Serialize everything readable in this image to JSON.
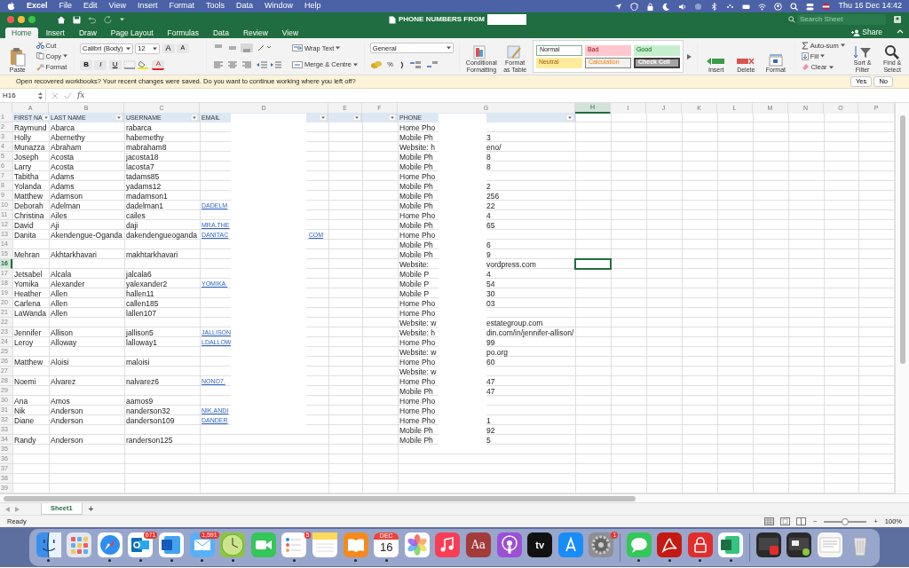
{
  "menu_bar": {
    "app": "Excel",
    "items": [
      "File",
      "Edit",
      "View",
      "Insert",
      "Format",
      "Tools",
      "Data",
      "Window",
      "Help"
    ],
    "clock": "Thu 16 Dec 14:42"
  },
  "title_bar": {
    "title": "PHONE NUMBERS FROM",
    "search": {
      "placeholder": "Search Sheet"
    }
  },
  "tabs": [
    {
      "label": "Home",
      "selected": true
    },
    {
      "label": "Insert",
      "selected": false
    },
    {
      "label": "Draw",
      "selected": false
    },
    {
      "label": "Page Layout",
      "selected": false
    },
    {
      "label": "Formulas",
      "selected": false
    },
    {
      "label": "Data",
      "selected": false
    },
    {
      "label": "Review",
      "selected": false
    },
    {
      "label": "View",
      "selected": false
    }
  ],
  "share": "Share",
  "ribbon": {
    "paste": "Paste",
    "clipboard": [
      "Cut",
      "Copy",
      "Format"
    ],
    "font": "Calibri (Body)",
    "font_size": "12",
    "grow": "A",
    "shrink": "A",
    "bold": "B",
    "italic": "I",
    "underline": "U",
    "font_color": "A",
    "wrap_text": "Wrap Text",
    "merge": "Merge & Centre",
    "number_format": "General",
    "percent": "%",
    "conditional": "Conditional Formatting",
    "format_table": "Format as Table",
    "styles": [
      {
        "label": "Normal",
        "kind": "normal"
      },
      {
        "label": "Bad",
        "kind": "bad"
      },
      {
        "label": "Good",
        "kind": "good"
      },
      {
        "label": "Neutral",
        "kind": "neutral"
      },
      {
        "label": "Calculation",
        "kind": "calculation"
      },
      {
        "label": "Check Cell",
        "kind": "check"
      }
    ],
    "cells": [
      "Insert",
      "Delete",
      "Format"
    ],
    "editing": [
      "Auto-sum",
      "Fill",
      "Clear"
    ],
    "sort": "Sort & Filter",
    "find": "Find & Select"
  },
  "notice": {
    "text": "Open recovered workbooks?  Your recent changes were saved. Do you want to continue working where you left off?",
    "buttons": [
      "Yes",
      "No"
    ]
  },
  "formula_bar": {
    "name_box": "H16",
    "fx": "fx"
  },
  "sheet": {
    "columns": [
      {
        "letter": "A",
        "selected": false
      },
      {
        "letter": "B",
        "selected": false
      },
      {
        "letter": "C",
        "selected": false
      },
      {
        "letter": "D",
        "selected": false
      },
      {
        "letter": "E",
        "selected": false
      },
      {
        "letter": "F",
        "selected": false
      },
      {
        "letter": "G",
        "selected": false
      },
      {
        "letter": "H",
        "selected": true
      },
      {
        "letter": "I",
        "selected": false
      },
      {
        "letter": "J",
        "selected": false
      },
      {
        "letter": "K",
        "selected": false
      },
      {
        "letter": "L",
        "selected": false
      },
      {
        "letter": "M",
        "selected": false
      },
      {
        "letter": "N",
        "selected": false
      },
      {
        "letter": "O",
        "selected": false
      },
      {
        "letter": "P",
        "selected": false
      }
    ],
    "rows": [
      {
        "number": "1",
        "selected": false,
        "kind": "header",
        "cells": {
          "A": {
            "text": "FIRST NA",
            "filter": true
          },
          "B": {
            "text": "LAST NAME",
            "filter": true
          },
          "C": {
            "text": "USERNAME",
            "filter": true
          },
          "D": {
            "text": "EMAIL",
            "filter": true
          },
          "E": {
            "filter": true
          },
          "F": {
            "filter": true
          },
          "G": {
            "text": "PHONE",
            "filter": true
          }
        }
      },
      {
        "number": "2",
        "selected": false,
        "kind": "data",
        "cells": {
          "A": "Raymund",
          "B": "Abarca",
          "C": "rabarca",
          "G": "Home Pho"
        }
      },
      {
        "number": "3",
        "selected": false,
        "kind": "data",
        "cells": {
          "A": "Holly",
          "B": "Abernethy",
          "C": "habernethy",
          "G": "Mobile Ph",
          "G_tail": "3"
        }
      },
      {
        "number": "4",
        "selected": false,
        "kind": "data",
        "cells": {
          "A": "Munazza",
          "B": "Abraham",
          "C": "mabraham8",
          "G": "Website: h",
          "G_tail": "eno/"
        }
      },
      {
        "number": "5",
        "selected": false,
        "kind": "data",
        "cells": {
          "A": "Joseph",
          "B": "Acosta",
          "C": "jacosta18",
          "G": "Mobile Ph",
          "G_tail": "8"
        }
      },
      {
        "number": "6",
        "selected": false,
        "kind": "data",
        "cells": {
          "A": "Larry",
          "B": "Acosta",
          "C": "lacosta7",
          "G": "Mobile Ph",
          "G_tail": "8"
        }
      },
      {
        "number": "7",
        "selected": false,
        "kind": "data",
        "cells": {
          "A": "Tabitha",
          "B": "Adams",
          "C": "tadams85",
          "G": "Home Pho"
        }
      },
      {
        "number": "8",
        "selected": false,
        "kind": "data",
        "cells": {
          "A": "Yolanda",
          "B": "Adams",
          "C": "yadams12",
          "G": "Mobile Ph",
          "G_tail": "2"
        }
      },
      {
        "number": "9",
        "selected": false,
        "kind": "data",
        "cells": {
          "A": "Matthew",
          "B": "Adamson",
          "C": "madamson1",
          "G": "Mobile Ph",
          "G_tail": "256"
        }
      },
      {
        "number": "10",
        "selected": false,
        "kind": "data",
        "cells": {
          "A": "Deborah",
          "B": "Adelman",
          "C": "dadelman1",
          "D": "DADELM",
          "G": "Mobile Ph",
          "G_tail": "22"
        }
      },
      {
        "number": "11",
        "selected": false,
        "kind": "data",
        "cells": {
          "A": "Christina",
          "B": "Ailes",
          "C": "cailes",
          "G": "Home Pho",
          "G_tail": "4"
        }
      },
      {
        "number": "12",
        "selected": false,
        "kind": "data",
        "cells": {
          "A": "David",
          "B": "Aji",
          "C": "daji",
          "D": "MRA.THE",
          "G": "Mobile Ph",
          "G_tail": "65"
        }
      },
      {
        "number": "13",
        "selected": false,
        "kind": "data",
        "cells": {
          "A": "Danita",
          "B": "Akendengue-Oganda",
          "C": "dakendengueoganda",
          "D": "DANITAC",
          "D_tail": "COM",
          "G": "Home Pho"
        }
      },
      {
        "number": "14",
        "selected": false,
        "kind": "data",
        "cells": {
          "G": "Mobile Ph",
          "G_tail": "6"
        }
      },
      {
        "number": "15",
        "selected": false,
        "kind": "data",
        "cells": {
          "A": "Mehran",
          "B": "Akhtarkhavari",
          "C": "makhtarkhavari",
          "G": "Mobile Ph",
          "G_tail": "9"
        }
      },
      {
        "number": "16",
        "selected": true,
        "kind": "data",
        "cells": {
          "G": "Website:",
          "G_tail": "vordpress.com"
        }
      },
      {
        "number": "17",
        "selected": false,
        "kind": "data",
        "cells": {
          "A": "Jetsabel",
          "B": "Alcala",
          "C": "jalcala6",
          "G": "Mobile P",
          "G_tail": "4"
        }
      },
      {
        "number": "18",
        "selected": false,
        "kind": "data",
        "cells": {
          "A": "Yomika",
          "B": "Alexander",
          "C": "yalexander2",
          "D": "YOMIKA.",
          "G": "Mobile P",
          "G_tail": "54"
        }
      },
      {
        "number": "19",
        "selected": false,
        "kind": "data",
        "cells": {
          "A": "Heather",
          "B": "Allen",
          "C": "hallen11",
          "G": "Mobile P",
          "G_tail": "30"
        }
      },
      {
        "number": "20",
        "selected": false,
        "kind": "data",
        "cells": {
          "A": "Carlena",
          "B": "Allen",
          "C": "callen185",
          "G": "Home Pho",
          "G_tail": "03"
        }
      },
      {
        "number": "21",
        "selected": false,
        "kind": "data",
        "cells": {
          "A": "LaWanda",
          "B": "Allen",
          "C": "lallen107",
          "G": "Home Pho"
        }
      },
      {
        "number": "22",
        "selected": false,
        "kind": "data",
        "cells": {
          "G": "Website: w",
          "G_tail": "estategroup.com"
        }
      },
      {
        "number": "23",
        "selected": false,
        "kind": "data",
        "cells": {
          "A": "Jennifer",
          "B": "Allison",
          "C": "jallison5",
          "D": "JALLISON",
          "G": "Website: h",
          "G_tail": "din.com/in/jennifer-allison/"
        }
      },
      {
        "number": "24",
        "selected": false,
        "kind": "data",
        "cells": {
          "A": "Leroy",
          "B": "Alloway",
          "C": "lalloway1",
          "D": "LDALLOW",
          "G": "Home Pho",
          "G_tail": "99"
        }
      },
      {
        "number": "25",
        "selected": false,
        "kind": "data",
        "cells": {
          "G": "Website: w",
          "G_tail": "po.org"
        }
      },
      {
        "number": "26",
        "selected": false,
        "kind": "data",
        "cells": {
          "A": "Matthew",
          "B": "Aloisi",
          "C": "maloisi",
          "G": "Home Pho",
          "G_tail": "60"
        }
      },
      {
        "number": "27",
        "selected": false,
        "kind": "data",
        "cells": {
          "G": "Website: w"
        }
      },
      {
        "number": "28",
        "selected": false,
        "kind": "data",
        "cells": {
          "A": "Noemi",
          "B": "Alvarez",
          "C": "nalvarez6",
          "D": "NONO7.",
          "G": "Home Pho",
          "G_tail": "47"
        }
      },
      {
        "number": "29",
        "selected": false,
        "kind": "data",
        "cells": {
          "G": "Mobile Ph",
          "G_tail": "47"
        }
      },
      {
        "number": "30",
        "selected": false,
        "kind": "data",
        "cells": {
          "A": "Ana",
          "B": "Amos",
          "C": "aamos9",
          "G": "Home Pho"
        }
      },
      {
        "number": "31",
        "selected": false,
        "kind": "data",
        "cells": {
          "A": "Nik",
          "B": "Anderson",
          "C": "nanderson32",
          "D": "NIK.ANDI",
          "G": "Home Pho"
        }
      },
      {
        "number": "32",
        "selected": false,
        "kind": "data",
        "cells": {
          "A": "Diane",
          "B": "Anderson",
          "C": "danderson109",
          "D": "DANDER",
          "G": "Home Pho",
          "G_tail": "1"
        }
      },
      {
        "number": "33",
        "selected": false,
        "kind": "data",
        "cells": {
          "G": "Mobile Ph",
          "G_tail": "92"
        }
      },
      {
        "number": "34",
        "selected": false,
        "kind": "data",
        "cells": {
          "A": "Randy",
          "B": "Anderson",
          "C": "randerson125",
          "G": "Mobile Ph",
          "G_tail": "5"
        }
      },
      {
        "number": "35",
        "selected": false,
        "kind": "data"
      },
      {
        "number": "36",
        "selected": false,
        "kind": "data"
      },
      {
        "number": "37",
        "selected": false,
        "kind": "data"
      },
      {
        "number": "38",
        "selected": false,
        "kind": "data"
      },
      {
        "number": "39",
        "selected": false,
        "kind": "data"
      }
    ]
  },
  "sheet_tabs": [
    {
      "label": "Sheet1",
      "selected": true
    }
  ],
  "add_sheet": "+",
  "status_bar": {
    "status": "Ready",
    "zoom_minus": "−",
    "zoom_plus": "+",
    "zoom_slider": {
      "level": 0.5
    },
    "zoom": "100%"
  },
  "dock": [
    {
      "kind": "finder",
      "running": true
    },
    {
      "kind": "launchpad",
      "running": false
    },
    {
      "kind": "safari",
      "running": true
    },
    {
      "kind": "outlook",
      "running": true,
      "badge": "671"
    },
    {
      "kind": "word",
      "running": true
    },
    {
      "kind": "mail",
      "running": true,
      "badge": "1,591"
    },
    {
      "kind": "clock",
      "running": true
    },
    {
      "kind": "facetime",
      "running": false
    },
    {
      "kind": "reminders",
      "running": true,
      "badge": "5"
    },
    {
      "kind": "notes",
      "running": false
    },
    {
      "kind": "books",
      "running": true
    },
    {
      "kind": "calendar",
      "running": true,
      "month": "DEC",
      "day": "16"
    },
    {
      "kind": "photos",
      "running": false
    },
    {
      "kind": "music",
      "running": false
    },
    {
      "kind": "dictionary",
      "running": false,
      "text": "Aa"
    },
    {
      "kind": "podcasts",
      "running": false
    },
    {
      "kind": "tv",
      "running": false,
      "text": "tv"
    },
    {
      "kind": "appstore",
      "running": false
    },
    {
      "kind": "settings",
      "running": false,
      "badge": "1"
    },
    {
      "kind": "separator"
    },
    {
      "kind": "messages",
      "running": true
    },
    {
      "kind": "acrobat",
      "running": true
    },
    {
      "kind": "vpn",
      "running": true
    },
    {
      "kind": "excel",
      "running": true
    },
    {
      "kind": "separator"
    },
    {
      "kind": "thumb_red",
      "running": false
    },
    {
      "kind": "thumb_green",
      "running": false
    },
    {
      "kind": "thumb_doc",
      "running": false
    },
    {
      "kind": "trash",
      "running": false
    }
  ]
}
